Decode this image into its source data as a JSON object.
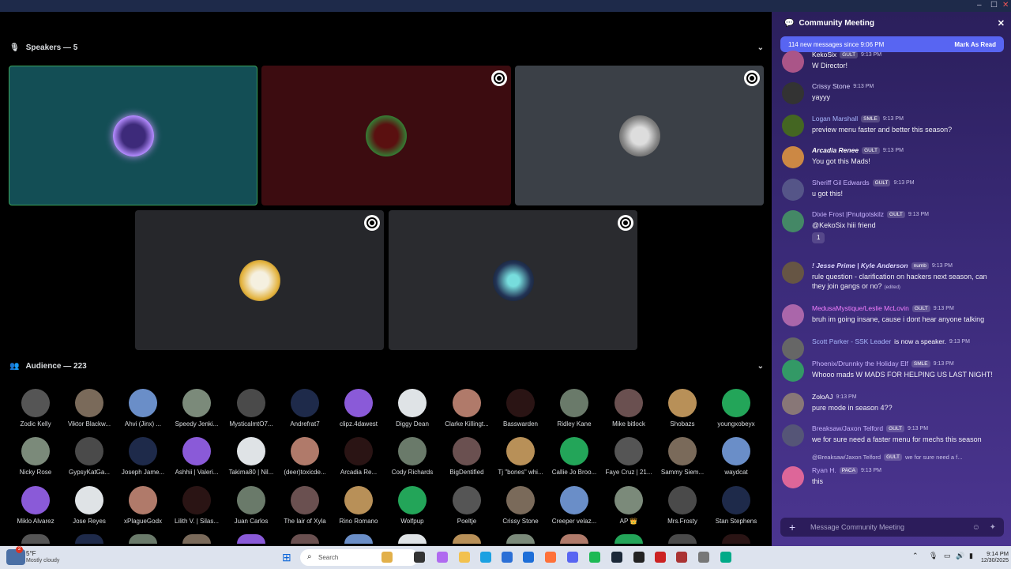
{
  "window": {
    "minimize": "–",
    "maximize": "☐",
    "close": "✕"
  },
  "speakers": {
    "header": "Speakers — 5"
  },
  "audience": {
    "header": "Audience — 223",
    "rows": [
      [
        "Zodic Kelly",
        "Viktor Blackw...",
        "Ahvi (Jinx) ...",
        "Speedy Jenki...",
        "MysticalmtO7...",
        "Andrefrat7",
        "clipz.4dawest",
        "Diggy Dean",
        "Clarke Killingt...",
        "Basswarden",
        "Ridley Kane",
        "Mike bitlock",
        "Shobazs",
        "youngxobeyx"
      ],
      [
        "Nicky Rose",
        "GypsyKatGa...",
        "Joseph Jame...",
        "Ashhii | Valeri...",
        "Takima80 | Nil...",
        "(deer)toxicde...",
        "Arcadia Re...",
        "Cody Richards",
        "BigDentified",
        "Tj \"bones\" whi...",
        "Callie Jo Broo...",
        "Faye Cruz | 21...",
        "Sammy Siem...",
        "waydcat"
      ],
      [
        "Miklo Alvarez",
        "Jose Reyes",
        "xPlagueGodx",
        "Lilith V. | Silas...",
        "Juan Carlos",
        "The lair of Xyla",
        "Rino Romano",
        "Wolfpup",
        "Poeltje",
        "Crissy Stone",
        "Creeper velaz...",
        "AP 👑",
        "Mrs.Frosty",
        "Stan Stephens"
      ]
    ]
  },
  "chat": {
    "title": "Community Meeting",
    "close": "✕",
    "banner": {
      "text": "114 new messages since 9:06 PM",
      "action": "Mark As Read"
    },
    "messages": [
      {
        "name": "KekoSix",
        "badge": "GULT",
        "time": "9:13 PM",
        "text": "W Director!"
      },
      {
        "name": "Crissy Stone",
        "badge": "",
        "time": "9:13 PM",
        "text": "yayyy"
      },
      {
        "name": "Logan Marshall",
        "badge": "SMLE",
        "time": "9:13 PM",
        "text": "preview menu faster and better this season?"
      },
      {
        "name": "Arcadia Renee",
        "badge": "GULT",
        "time": "9:13 PM",
        "text": "You got this Mads!"
      },
      {
        "name": "Sheriff Gil Edwards",
        "badge": "GULT",
        "time": "9:13 PM",
        "text": "u got this!"
      },
      {
        "name": "Dixie Frost |Pnutgotskilz",
        "badge": "GULT",
        "time": "9:13 PM",
        "text": "@KekoSix hiii friend",
        "reaction": "1"
      },
      {
        "name": "! Jesse Prime | Kyle Anderson",
        "badge": "numb",
        "time": "9:13 PM",
        "text": "rule question - clarification on hackers next season, can they join gangs or no?",
        "edited": "(edited)"
      },
      {
        "name": "MedusaMystique/Leslie McLovin",
        "badge": "GULT",
        "time": "9:13 PM",
        "text": "bruh im going insane, cause i dont hear anyone talking"
      },
      {
        "name": "Scott Parker - SSK Leader",
        "badge": "",
        "time": "9:13 PM",
        "text": "is now a speaker."
      },
      {
        "name": "Phoenix/Drunnky the Holiday Elf",
        "badge": "SMLE",
        "time": "9:13 PM",
        "text": "Whooo mads W MADS FOR HELPING US LAST NIGHT!"
      },
      {
        "name": "ZoloAJ",
        "badge": "",
        "time": "9:13 PM",
        "text": "pure mode in season 4??"
      },
      {
        "name": "Breaksaw/Jaxon Telford",
        "badge": "GULT",
        "time": "9:13 PM",
        "text": "we for sure need a faster menu for mechs this season"
      },
      {
        "name": "Ryan H.",
        "badge": "PACA",
        "time": "9:13 PM",
        "text": "this",
        "reply": "@Breaksaw/Jaxon Telford",
        "replyTag": "GULT",
        "replyText": "we for sure need a f..."
      }
    ],
    "placeholder": "Message Community Meeting"
  },
  "taskbar": {
    "temp": "5°F",
    "weather": "Mostly cloudy",
    "badge": "2",
    "search": "Search",
    "time": "9:14 PM",
    "date": "12/30/2025"
  }
}
